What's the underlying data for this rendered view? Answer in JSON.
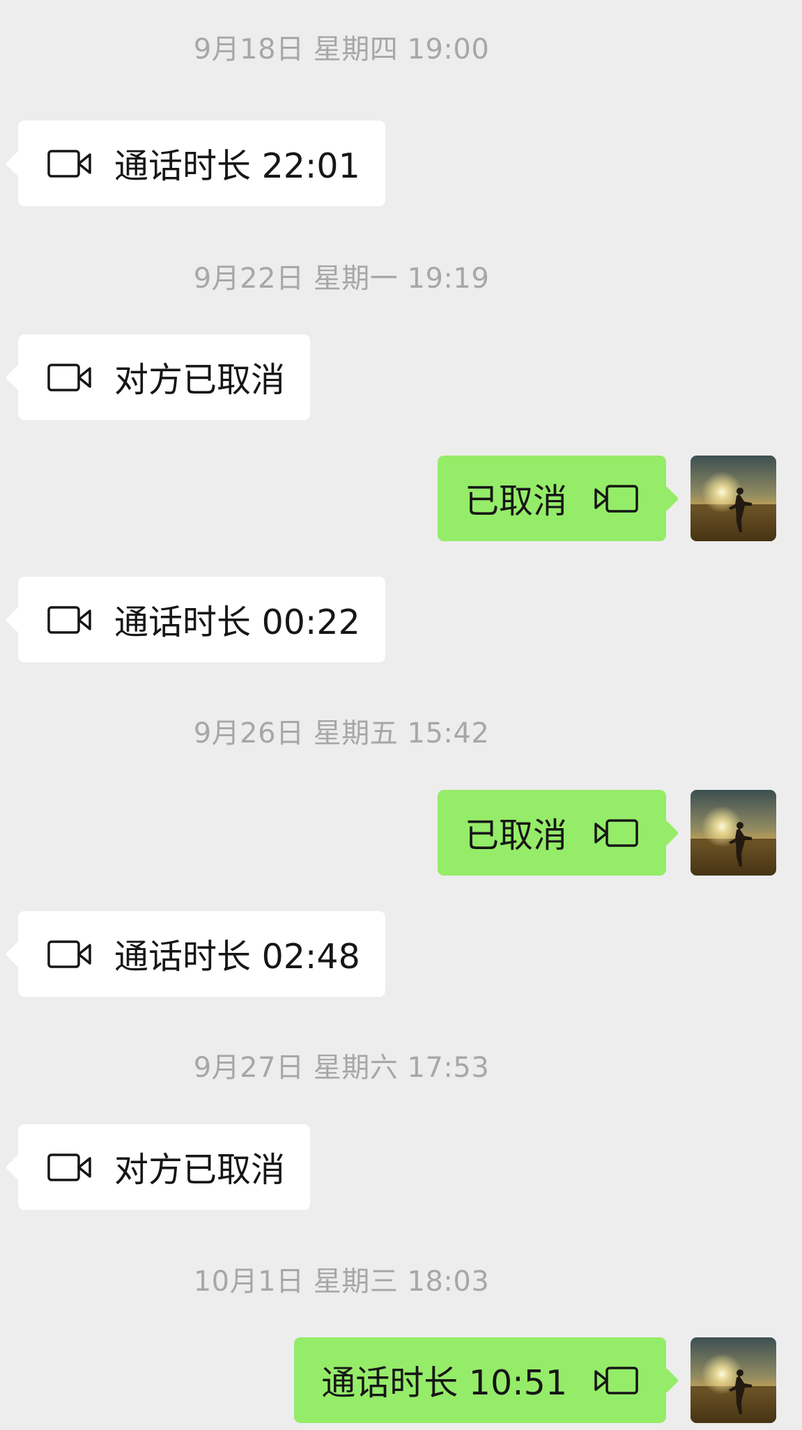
{
  "chat": {
    "messages": [
      {
        "type": "timestamp",
        "text": "9月18日 星期四 19:00"
      },
      {
        "type": "call",
        "side": "in",
        "text": "通话时长 22:01",
        "icon": "video-call-icon"
      },
      {
        "type": "timestamp",
        "text": "9月22日 星期一 19:19"
      },
      {
        "type": "call",
        "side": "in",
        "text": "对方已取消",
        "icon": "video-call-icon"
      },
      {
        "type": "call",
        "side": "out",
        "text": "已取消",
        "icon": "video-call-icon"
      },
      {
        "type": "call",
        "side": "in",
        "text": "通话时长 00:22",
        "icon": "video-call-icon"
      },
      {
        "type": "timestamp",
        "text": "9月26日 星期五 15:42"
      },
      {
        "type": "call",
        "side": "out",
        "text": "已取消",
        "icon": "video-call-icon"
      },
      {
        "type": "call",
        "side": "in",
        "text": "通话时长 02:48",
        "icon": "video-call-icon"
      },
      {
        "type": "timestamp",
        "text": "9月27日 星期六 17:53"
      },
      {
        "type": "call",
        "side": "in",
        "text": "对方已取消",
        "icon": "video-call-icon"
      },
      {
        "type": "timestamp",
        "text": "10月1日 星期三 18:03"
      },
      {
        "type": "call",
        "side": "out",
        "text": "通话时长 10:51",
        "icon": "video-call-icon"
      }
    ]
  },
  "colors": {
    "background": "#ededed",
    "incoming_bubble": "#ffffff",
    "outgoing_bubble": "#95ec69",
    "timestamp_text": "#a7a7a7",
    "message_text": "#161616"
  }
}
